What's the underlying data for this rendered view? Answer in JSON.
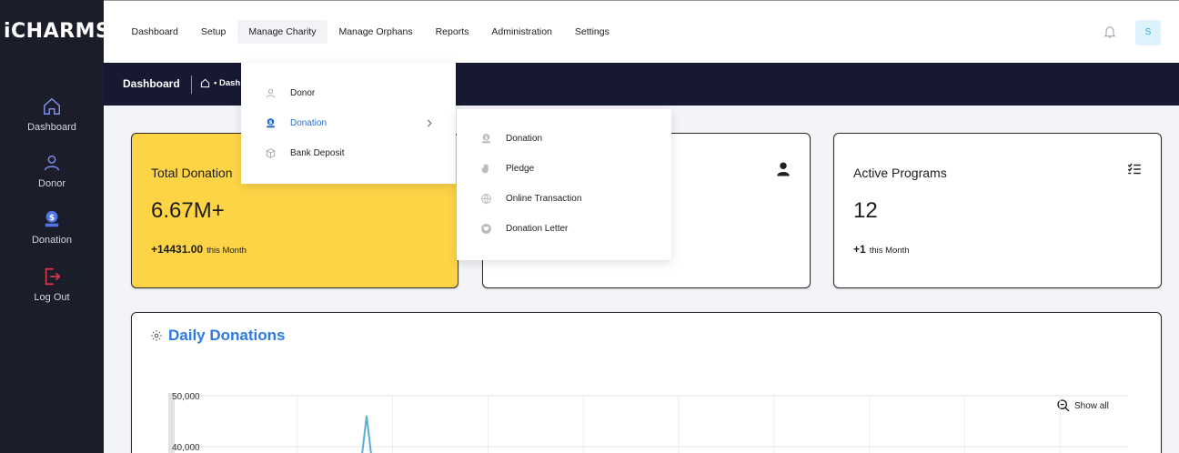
{
  "brand": {
    "logo_text": "iCHARMS"
  },
  "sidebar": {
    "items": [
      {
        "label": "Dashboard",
        "icon": "home-icon"
      },
      {
        "label": "Donor",
        "icon": "user-icon"
      },
      {
        "label": "Donation",
        "icon": "donation-icon"
      },
      {
        "label": "Log Out",
        "icon": "logout-icon"
      }
    ]
  },
  "topnav": {
    "items": [
      {
        "label": "Dashboard"
      },
      {
        "label": "Setup"
      },
      {
        "label": "Manage Charity"
      },
      {
        "label": "Manage Orphans"
      },
      {
        "label": "Reports"
      },
      {
        "label": "Administration"
      },
      {
        "label": "Settings"
      }
    ],
    "avatar_initial": "S"
  },
  "pagebar": {
    "title": "Dashboard",
    "breadcrumb": "• Dash"
  },
  "menu_charity": {
    "items": [
      {
        "label": "Donor",
        "icon": "user-icon"
      },
      {
        "label": "Donation",
        "icon": "donation-icon",
        "has_submenu": true
      },
      {
        "label": "Bank Deposit",
        "icon": "cube-icon"
      }
    ]
  },
  "submenu_donation": {
    "items": [
      {
        "label": "Donation",
        "icon": "donation-icon"
      },
      {
        "label": "Pledge",
        "icon": "hand-icon"
      },
      {
        "label": "Online Transaction",
        "icon": "globe-icon"
      },
      {
        "label": "Donation Letter",
        "icon": "heart-icon"
      }
    ]
  },
  "cards": [
    {
      "title": "Total Donation",
      "value": "6.67M+",
      "delta": "+14431.00",
      "delta_label": "this Month"
    },
    {
      "title": "",
      "value": "",
      "delta": "",
      "delta_label": ""
    },
    {
      "title": "Active Programs",
      "value": "12",
      "delta": "+1",
      "delta_label": "this Month"
    }
  ],
  "chart": {
    "title": "Daily Donations",
    "show_all": "Show all",
    "y_ticks": [
      "50,000",
      "40,000"
    ]
  },
  "chart_data": {
    "type": "line",
    "title": "Daily Donations",
    "y_ticks": [
      50000,
      40000
    ],
    "ylim": [
      40000,
      50000
    ],
    "series": [
      {
        "values": [
          null,
          null,
          null,
          38500,
          46000,
          38500
        ]
      }
    ]
  },
  "colors": {
    "sidebar_bg": "#1c1d2b",
    "pagebar_bg": "#171933",
    "accent_blue": "#2e7ae0",
    "card_yellow": "#fdd446",
    "line_color": "#5aaed6"
  }
}
